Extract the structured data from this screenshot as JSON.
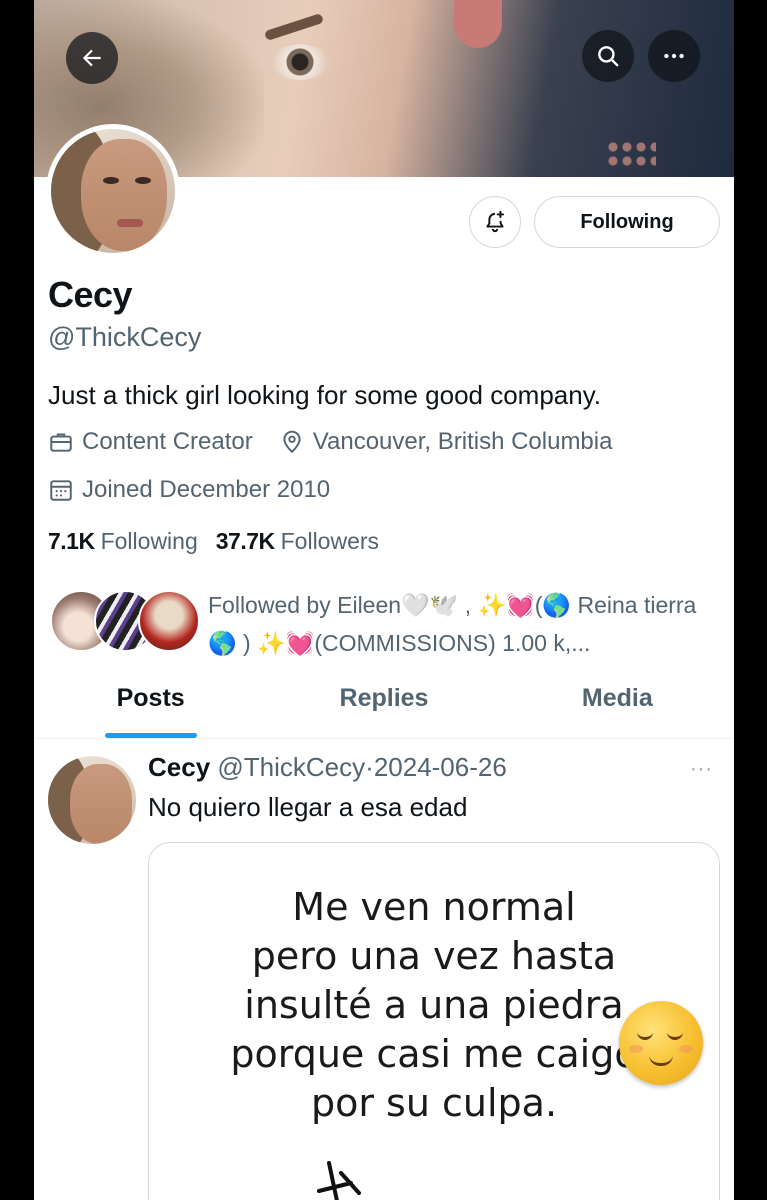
{
  "header": {
    "back_icon": "arrow-left-icon",
    "search_icon": "search-icon",
    "more_icon": "more-horizontal-icon"
  },
  "profile": {
    "name": "Cecy",
    "handle": "@ThickCecy",
    "bio": "Just a thick girl looking for some good company.",
    "category": "Content Creator",
    "location": "Vancouver, British Columbia",
    "joined": "Joined December 2010",
    "following_count": "7.1K",
    "following_label": "Following",
    "followers_count": "37.7K",
    "followers_label": "Followers",
    "follow_button_label": "Following",
    "followed_by_text": "Followed by Eileen🤍🕊️ , ✨💓(🌎 Reina tierra🌎 ) ✨💓(COMMISSIONS) 1.00 k,..."
  },
  "tabs": [
    {
      "label": "Posts",
      "active": true
    },
    {
      "label": "Replies",
      "active": false
    },
    {
      "label": "Media",
      "active": false
    }
  ],
  "tweet": {
    "author": "Cecy",
    "handle": "@ThickCecy",
    "separator": "·",
    "date": "2024-06-26",
    "text": "No quiero llegar a esa edad",
    "more": "···",
    "media_text": [
      "Me ven normal",
      "pero una vez hasta",
      "insulté a una piedra",
      "porque casi me caigo",
      "por su culpa."
    ]
  },
  "colors": {
    "accent": "#1d9bf0",
    "text_primary": "#0f1419",
    "text_secondary": "#536471",
    "border": "#cfd9de"
  }
}
